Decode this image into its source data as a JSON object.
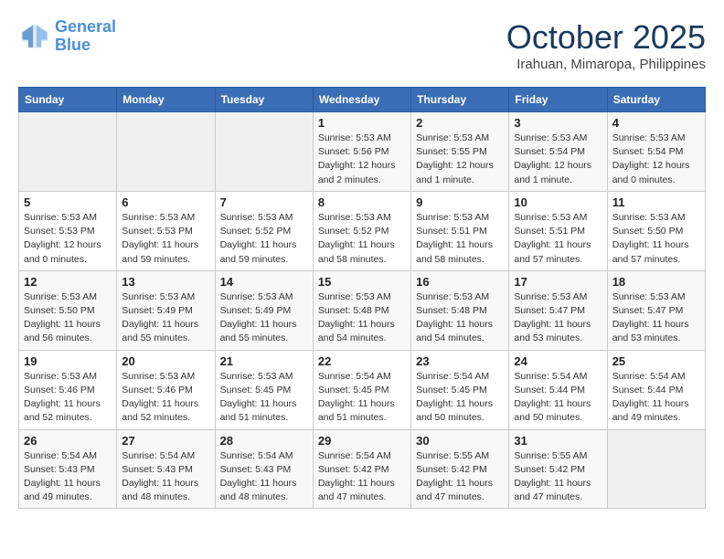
{
  "header": {
    "logo_line1": "General",
    "logo_line2": "Blue",
    "month": "October 2025",
    "location": "Irahuan, Mimaropa, Philippines"
  },
  "days_of_week": [
    "Sunday",
    "Monday",
    "Tuesday",
    "Wednesday",
    "Thursday",
    "Friday",
    "Saturday"
  ],
  "weeks": [
    [
      {
        "day": "",
        "info": ""
      },
      {
        "day": "",
        "info": ""
      },
      {
        "day": "",
        "info": ""
      },
      {
        "day": "1",
        "info": "Sunrise: 5:53 AM\nSunset: 5:56 PM\nDaylight: 12 hours and 2 minutes."
      },
      {
        "day": "2",
        "info": "Sunrise: 5:53 AM\nSunset: 5:55 PM\nDaylight: 12 hours and 1 minute."
      },
      {
        "day": "3",
        "info": "Sunrise: 5:53 AM\nSunset: 5:54 PM\nDaylight: 12 hours and 1 minute."
      },
      {
        "day": "4",
        "info": "Sunrise: 5:53 AM\nSunset: 5:54 PM\nDaylight: 12 hours and 0 minutes."
      }
    ],
    [
      {
        "day": "5",
        "info": "Sunrise: 5:53 AM\nSunset: 5:53 PM\nDaylight: 12 hours and 0 minutes."
      },
      {
        "day": "6",
        "info": "Sunrise: 5:53 AM\nSunset: 5:53 PM\nDaylight: 11 hours and 59 minutes."
      },
      {
        "day": "7",
        "info": "Sunrise: 5:53 AM\nSunset: 5:52 PM\nDaylight: 11 hours and 59 minutes."
      },
      {
        "day": "8",
        "info": "Sunrise: 5:53 AM\nSunset: 5:52 PM\nDaylight: 11 hours and 58 minutes."
      },
      {
        "day": "9",
        "info": "Sunrise: 5:53 AM\nSunset: 5:51 PM\nDaylight: 11 hours and 58 minutes."
      },
      {
        "day": "10",
        "info": "Sunrise: 5:53 AM\nSunset: 5:51 PM\nDaylight: 11 hours and 57 minutes."
      },
      {
        "day": "11",
        "info": "Sunrise: 5:53 AM\nSunset: 5:50 PM\nDaylight: 11 hours and 57 minutes."
      }
    ],
    [
      {
        "day": "12",
        "info": "Sunrise: 5:53 AM\nSunset: 5:50 PM\nDaylight: 11 hours and 56 minutes."
      },
      {
        "day": "13",
        "info": "Sunrise: 5:53 AM\nSunset: 5:49 PM\nDaylight: 11 hours and 55 minutes."
      },
      {
        "day": "14",
        "info": "Sunrise: 5:53 AM\nSunset: 5:49 PM\nDaylight: 11 hours and 55 minutes."
      },
      {
        "day": "15",
        "info": "Sunrise: 5:53 AM\nSunset: 5:48 PM\nDaylight: 11 hours and 54 minutes."
      },
      {
        "day": "16",
        "info": "Sunrise: 5:53 AM\nSunset: 5:48 PM\nDaylight: 11 hours and 54 minutes."
      },
      {
        "day": "17",
        "info": "Sunrise: 5:53 AM\nSunset: 5:47 PM\nDaylight: 11 hours and 53 minutes."
      },
      {
        "day": "18",
        "info": "Sunrise: 5:53 AM\nSunset: 5:47 PM\nDaylight: 11 hours and 53 minutes."
      }
    ],
    [
      {
        "day": "19",
        "info": "Sunrise: 5:53 AM\nSunset: 5:46 PM\nDaylight: 11 hours and 52 minutes."
      },
      {
        "day": "20",
        "info": "Sunrise: 5:53 AM\nSunset: 5:46 PM\nDaylight: 11 hours and 52 minutes."
      },
      {
        "day": "21",
        "info": "Sunrise: 5:53 AM\nSunset: 5:45 PM\nDaylight: 11 hours and 51 minutes."
      },
      {
        "day": "22",
        "info": "Sunrise: 5:54 AM\nSunset: 5:45 PM\nDaylight: 11 hours and 51 minutes."
      },
      {
        "day": "23",
        "info": "Sunrise: 5:54 AM\nSunset: 5:45 PM\nDaylight: 11 hours and 50 minutes."
      },
      {
        "day": "24",
        "info": "Sunrise: 5:54 AM\nSunset: 5:44 PM\nDaylight: 11 hours and 50 minutes."
      },
      {
        "day": "25",
        "info": "Sunrise: 5:54 AM\nSunset: 5:44 PM\nDaylight: 11 hours and 49 minutes."
      }
    ],
    [
      {
        "day": "26",
        "info": "Sunrise: 5:54 AM\nSunset: 5:43 PM\nDaylight: 11 hours and 49 minutes."
      },
      {
        "day": "27",
        "info": "Sunrise: 5:54 AM\nSunset: 5:43 PM\nDaylight: 11 hours and 48 minutes."
      },
      {
        "day": "28",
        "info": "Sunrise: 5:54 AM\nSunset: 5:43 PM\nDaylight: 11 hours and 48 minutes."
      },
      {
        "day": "29",
        "info": "Sunrise: 5:54 AM\nSunset: 5:42 PM\nDaylight: 11 hours and 47 minutes."
      },
      {
        "day": "30",
        "info": "Sunrise: 5:55 AM\nSunset: 5:42 PM\nDaylight: 11 hours and 47 minutes."
      },
      {
        "day": "31",
        "info": "Sunrise: 5:55 AM\nSunset: 5:42 PM\nDaylight: 11 hours and 47 minutes."
      },
      {
        "day": "",
        "info": ""
      }
    ]
  ]
}
